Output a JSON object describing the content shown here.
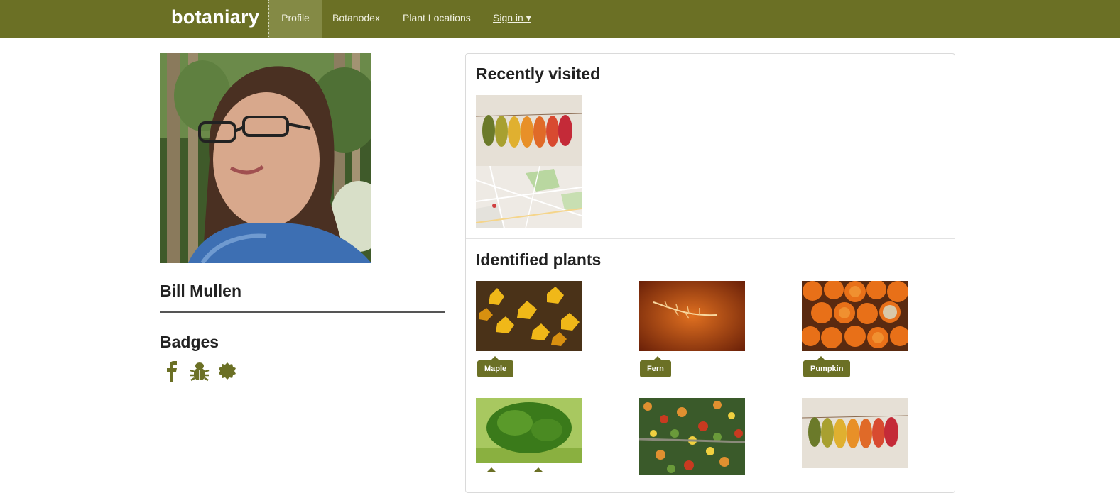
{
  "navbar": {
    "brand": "botaniary",
    "items": [
      {
        "label": "Profile"
      },
      {
        "label": "Botanodex"
      },
      {
        "label": "Plant Locations"
      },
      {
        "label": "Sign in ▾"
      }
    ],
    "active": "Profile",
    "color": "#6b7025"
  },
  "profile": {
    "name": "Bill Mullen",
    "badges_title": "Badges",
    "badges": [
      "facebook-icon",
      "bug-icon",
      "seal-badge-icon"
    ]
  },
  "recent": {
    "title": "Recently visited",
    "items": [
      "autumn-leaves-photo",
      "map-thumbnail"
    ]
  },
  "identified": {
    "title": "Identified plants",
    "plants": [
      {
        "name": "Maple",
        "image": "yellow-maple-leaves"
      },
      {
        "name": "Fern",
        "image": "orange-fern"
      },
      {
        "name": "Pumpkin",
        "image": "pumpkins"
      },
      {
        "name": "",
        "image": "green-shrub"
      },
      {
        "name": "",
        "image": "autumn-forest-aerial"
      },
      {
        "name": "",
        "image": "autumn-leaves-row"
      }
    ]
  }
}
